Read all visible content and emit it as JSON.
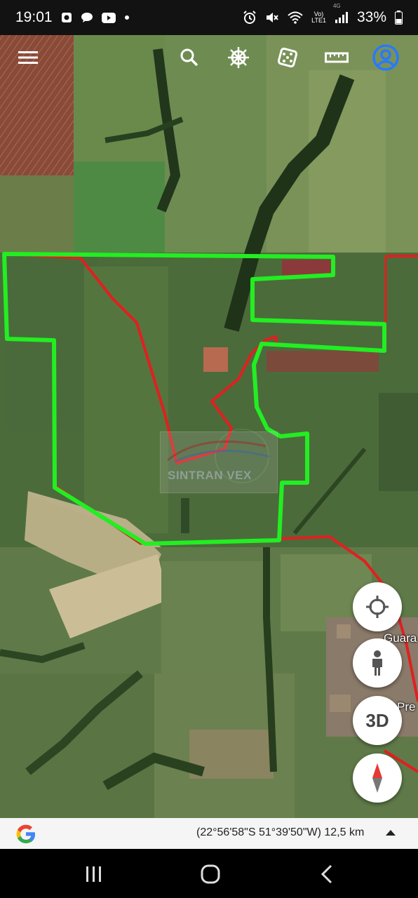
{
  "status_bar": {
    "time": "19:01",
    "left_icons": [
      "screen-record-icon",
      "chat-bubble-icon",
      "youtube-icon",
      "dot-icon"
    ],
    "right_icons": [
      "alarm-icon",
      "mute-icon",
      "wifi-icon",
      "volte-icon",
      "signal-icon",
      "battery-icon"
    ],
    "volte_line1": "Vo)",
    "volte_line2": "LTE1",
    "network": "4G",
    "battery": "33%"
  },
  "toolbar": {
    "items": [
      "menu-icon",
      "search-icon",
      "voyager-wheel-icon",
      "dice-icon",
      "ruler-icon",
      "account-icon"
    ]
  },
  "map": {
    "colors": {
      "primary_boundary": "#22ee22",
      "secondary_boundary": "#e02020"
    },
    "place_labels": [
      "Guara",
      "Pre"
    ],
    "watermark": "SINTRAN VEX"
  },
  "controls": {
    "locate": "crosshair-icon",
    "street_view": "pegman-icon",
    "three_d": "3D",
    "compass": "compass-icon"
  },
  "bottom_bar": {
    "coordinates": "(22°56'58\"S 51°39'50\"W) 12,5 km"
  },
  "nav_bar": {
    "items": [
      "recents-icon",
      "home-icon",
      "back-icon"
    ]
  }
}
